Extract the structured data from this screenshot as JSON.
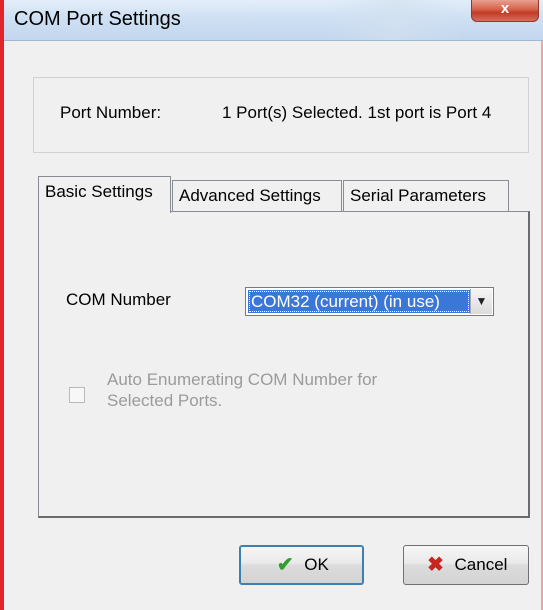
{
  "window": {
    "title": "COM Port Settings",
    "close_label": "x"
  },
  "port": {
    "label": "Port Number:",
    "value": "1 Port(s) Selected. 1st port is Port 4"
  },
  "tabs": [
    {
      "label": "Basic Settings",
      "active": true
    },
    {
      "label": "Advanced Settings",
      "active": false
    },
    {
      "label": "Serial Parameters",
      "active": false
    }
  ],
  "basic": {
    "com_label": "COM Number",
    "com_value": "COM32 (current) (in use)",
    "auto_enum_label": "Auto Enumerating COM Number for Selected Ports.",
    "auto_enum_checked": false,
    "auto_enum_disabled": true
  },
  "buttons": {
    "ok_label": "OK",
    "cancel_label": "Cancel"
  },
  "icons": {
    "ok": "checkmark-icon",
    "cancel": "x-icon",
    "dropdown": "chevron-down-icon"
  },
  "colors": {
    "selection": "#3b77d8",
    "window_border": "#e0262c",
    "ok_icon": "#2f9e2f",
    "cancel_icon": "#c8261e"
  }
}
